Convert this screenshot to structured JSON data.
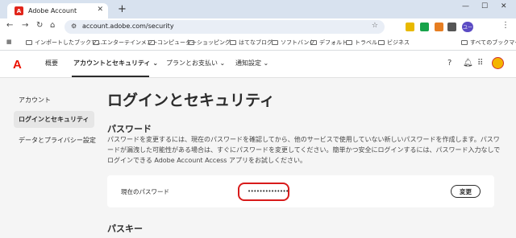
{
  "browser": {
    "tab_title": "Adobe Account",
    "tab_close": "✕",
    "new_tab": "+",
    "url": "account.adobe.com/security",
    "bookmarks": [
      "インポートしたブックマ...",
      "エンターテインメント",
      "コンピューター",
      "ショッピング",
      "はてなブログ",
      "ソフトバンク",
      "デフォルト",
      "トラベル",
      "ビジネス",
      "すべてのブックマーク"
    ],
    "profile_initial": "ユー"
  },
  "header": {
    "logo": "A",
    "nav": [
      "概要",
      "アカウントとセキュリティ",
      "プランとお支払い",
      "通知設定"
    ],
    "chevron": "⌄"
  },
  "sidebar": {
    "items": [
      "アカウント",
      "ログインとセキュリティ",
      "データとプライバシー設定"
    ]
  },
  "main": {
    "title": "ログインとセキュリティ",
    "password_section": {
      "heading": "パスワード",
      "description": "パスワードを変更するには、現在のパスワードを確認してから、他のサービスで使用していない新しいパスワードを作成します。パスワードが漏洩した可能性がある場合は、すぐにパスワードを変更してください。簡単かつ安全にログインするには、パスワード入力なしでログインできる Adobe Account Access アプリをお試しください。",
      "current_label": "現在のパスワード",
      "masked_value": "••••••••••••••",
      "change_button": "変更"
    },
    "passkey_section": {
      "heading": "パスキー"
    }
  },
  "colors": {
    "adobe_red": "#eb1000",
    "highlight_red": "#d81b1b"
  }
}
